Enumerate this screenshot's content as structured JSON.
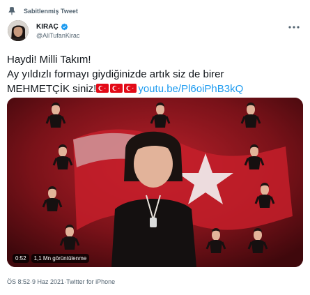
{
  "pinned": {
    "label": "Sabitlenmiş Tweet",
    "icon": "pin-icon"
  },
  "author": {
    "name": "KIRAÇ",
    "handle": "@AliTufanKirac",
    "verified_icon": "verified-badge-icon",
    "avatar": "profile-avatar"
  },
  "menu": {
    "icon": "more-options-icon"
  },
  "tweet": {
    "line1": "Haydi! Milli Takım!",
    "line2": "Ay yıldızlı formayı giydiğinizde artık siz de birer",
    "line3_text": "MEHMETÇİK siniz!",
    "flags": [
      "turkey-flag-emoji",
      "turkey-flag-emoji",
      "turkey-flag-emoji"
    ],
    "link": "youtu.be/Pl6oiPhB3kQ"
  },
  "media": {
    "duration": "0:52",
    "views": "1,1 Mn görüntülenme"
  },
  "footer": {
    "time": "ÖS 8:52",
    "sep1": " · ",
    "date": "9 Haz 2021",
    "sep2": " · ",
    "source": "Twitter for iPhone"
  },
  "colors": {
    "link": "#1d9bf0",
    "verified": "#1d9bf0",
    "muted": "#536471",
    "flag_red": "#e30a17",
    "video_bg": "#5c0e13"
  }
}
